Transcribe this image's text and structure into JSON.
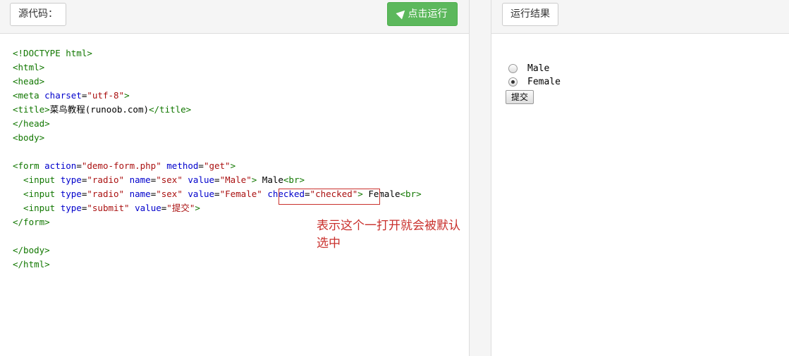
{
  "left_panel": {
    "tab_label": "源代码：",
    "run_label": "点击运行"
  },
  "right_panel": {
    "tab_label": "运行结果"
  },
  "code": {
    "l1": "<!DOCTYPE html>",
    "l2": "<html>",
    "l3": "<head>",
    "l4_a": "<meta ",
    "l4_b": "charset",
    "l4_c": "=",
    "l4_d": "\"utf-8\"",
    "l4_e": ">",
    "l5_a": "<title>",
    "l5_b": "菜鸟教程(runoob.com)",
    "l5_c": "</title>",
    "l6": "</head>",
    "l7": "<body>",
    "l9_a": "<form ",
    "l9_b": "action",
    "l9_c": "=",
    "l9_d": "\"demo-form.php\"",
    "l9_e": " ",
    "l9_f": "method",
    "l9_g": "=",
    "l9_h": "\"get\"",
    "l9_i": ">",
    "l10_a": "  <input ",
    "l10_b": "type",
    "l10_c": "=",
    "l10_d": "\"radio\"",
    "l10_e": " ",
    "l10_f": "name",
    "l10_g": "=",
    "l10_h": "\"sex\"",
    "l10_i": " ",
    "l10_j": "value",
    "l10_k": "=",
    "l10_l": "\"Male\"",
    "l10_m": ">",
    "l10_n": " Male",
    "l10_o": "<br>",
    "l11_a": "  <input ",
    "l11_b": "type",
    "l11_c": "=",
    "l11_d": "\"radio\"",
    "l11_e": " ",
    "l11_f": "name",
    "l11_g": "=",
    "l11_h": "\"sex\"",
    "l11_i": " ",
    "l11_j": "value",
    "l11_k": "=",
    "l11_l": "\"Female\"",
    "l11_m": " ",
    "l11_n": "checked",
    "l11_o": "=",
    "l11_p": "\"checked\"",
    "l11_q": ">",
    "l11_r": " Female",
    "l11_s": "<br>",
    "l12_a": "  <input ",
    "l12_b": "type",
    "l12_c": "=",
    "l12_d": "\"submit\"",
    "l12_e": " ",
    "l12_f": "value",
    "l12_g": "=",
    "l12_h": "\"提交\"",
    "l12_i": ">",
    "l13": "</form>",
    "l15": "</body>",
    "l16": "</html>"
  },
  "annotation": "表示这个一打开就会被默认选中",
  "result": {
    "options": [
      "Male",
      "Female"
    ],
    "checked_option": "Female",
    "submit_label": "提交"
  }
}
